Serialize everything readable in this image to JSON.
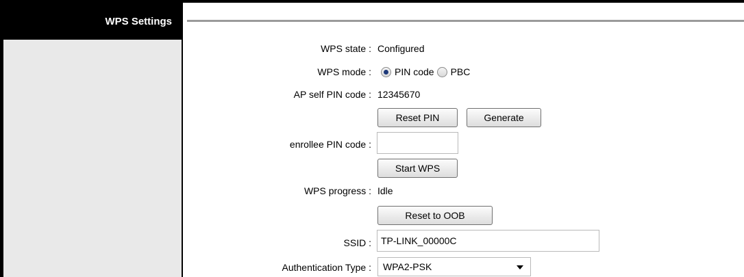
{
  "sidebar": {
    "title": "WPS Settings"
  },
  "form": {
    "wps_state": {
      "label": "WPS state :",
      "value": "Configured"
    },
    "wps_mode": {
      "label": "WPS mode :",
      "options": [
        "PIN code",
        "PBC"
      ],
      "selected": "PIN code"
    },
    "ap_pin": {
      "label": "AP self PIN code :",
      "value": "12345670"
    },
    "reset_pin_button": "Reset PIN",
    "generate_button": "Generate",
    "enrollee_pin": {
      "label": "enrollee PIN code :",
      "value": ""
    },
    "start_wps_button": "Start WPS",
    "wps_progress": {
      "label": "WPS progress :",
      "value": "Idle"
    },
    "reset_oob_button": "Reset to OOB",
    "ssid": {
      "label": "SSID :",
      "value": "TP-LINK_00000C"
    },
    "auth_type": {
      "label": "Authentication Type :",
      "value": "WPA2-PSK"
    }
  },
  "icons": {
    "radio_selected": "radio-selected-icon",
    "radio_unselected": "radio-unselected-icon",
    "dropdown": "dropdown-arrow-icon"
  }
}
